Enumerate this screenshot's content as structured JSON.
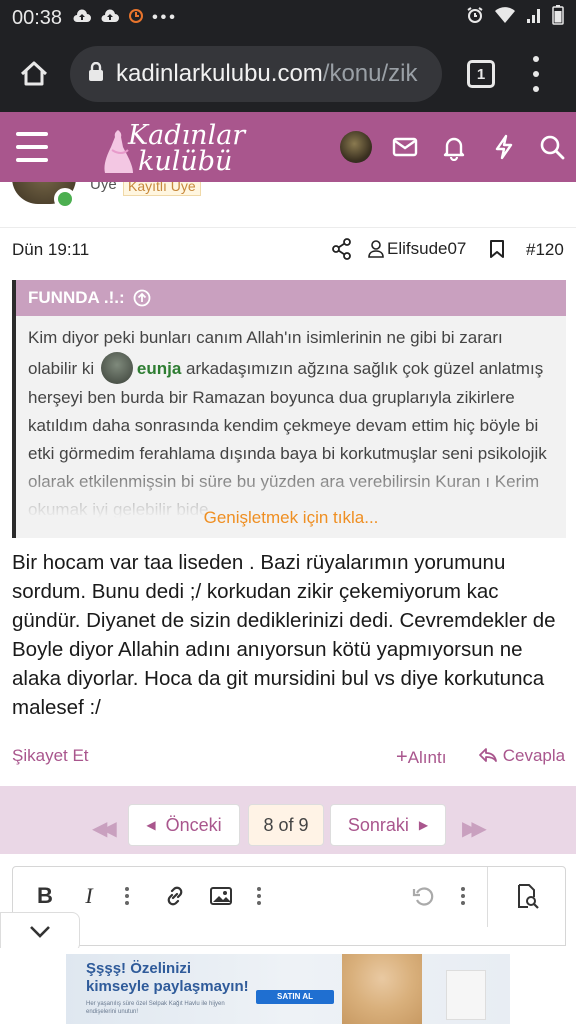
{
  "status_bar": {
    "time": "00:38"
  },
  "browser": {
    "url_host": "kadinlarkulubu.com",
    "url_path": "/konu/zik",
    "tab_count": "1"
  },
  "site": {
    "logo_line1": "Kadınlar",
    "logo_line2": "kulübü"
  },
  "post": {
    "user_role": "Üye",
    "user_badge": "Kayıtlı Üye",
    "date": "Dün 19:11",
    "author": "Elifsude07",
    "number": "#120",
    "quote": {
      "author_head": "FUNNDA .!.:",
      "text_before_mention": "Kim diyor peki bunları canım Allah'ın isimlerinin ne gibi bi zararı olabilir ki",
      "mention": "eunja",
      "text_after_mention": "arkadaşımızın ağzına sağlık çok güzel anlatmış herşeyi ben burda bir Ramazan boyunca dua gruplarıyla zikirlere katıldım daha sonrasında kendim çekmeye devam ettim hiç böyle bi etki görmedim ferahlama dışında baya bi korkutmuşlar seni psikolojik olarak etkilenmişsin bi süre bu yüzden ara verebilirsin Kuran ı Kerim okumak iyi gelebilir bide",
      "expand_label": "Genişletmek için tıkla..."
    },
    "message": "Bir hocam var taa liseden . Bazi rüyalarımın yorumunu sordum. Bunu dedi ;/ korkudan zikir çekemiyorum kac gündür. Diyanet de sizin dediklerinizi dedi. Cevremdekler de Boyle diyor Allahin adını anıyorsun kötü yapmıyorsun ne alaka diyorlar. Hoca da git mursidini bul vs diye korkutunca malesef :/",
    "actions": {
      "report": "Şikayet Et",
      "quote": "Alıntı",
      "reply": "Cevapla"
    }
  },
  "pagination": {
    "prev": "Önceki",
    "current": "8 of 9",
    "next": "Sonraki"
  },
  "editor": {
    "bold": "B",
    "italic": "I"
  },
  "ad": {
    "headline1": "Şşşş! Özelinizi",
    "headline2": "kimseyle paylaşmayın!",
    "small_text": "Her yaşanılış süre özel Selpak Kağıt Havlu ile hijyen endişelerini unutun!",
    "cta": "SATIN AL"
  },
  "colors": {
    "brand": "#a9568d",
    "quote_head": "#c9a0bf",
    "expand": "#ef8f22",
    "pager_bg": "#ead7e6",
    "mention": "#2e7d32"
  }
}
